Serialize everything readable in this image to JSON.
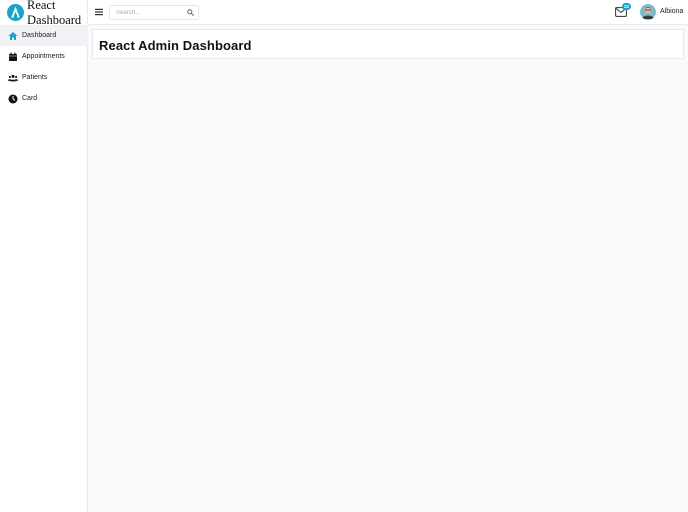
{
  "brand": {
    "line1": "React",
    "line2": "Dashboard"
  },
  "sidebar": {
    "items": [
      {
        "label": "Dashboard",
        "icon": "home-icon",
        "active": true
      },
      {
        "label": "Appointments",
        "icon": "calendar-icon",
        "active": false
      },
      {
        "label": "Patients",
        "icon": "users-icon",
        "active": false
      },
      {
        "label": "Card",
        "icon": "clock-icon",
        "active": false
      }
    ]
  },
  "header": {
    "search_placeholder": "Search...",
    "mail_badge": "22",
    "user_name": "Albiona"
  },
  "main": {
    "page_title": "React Admin Dashboard"
  },
  "colors": {
    "accent": "#1aa3c6",
    "background": "#f8f9fb"
  }
}
